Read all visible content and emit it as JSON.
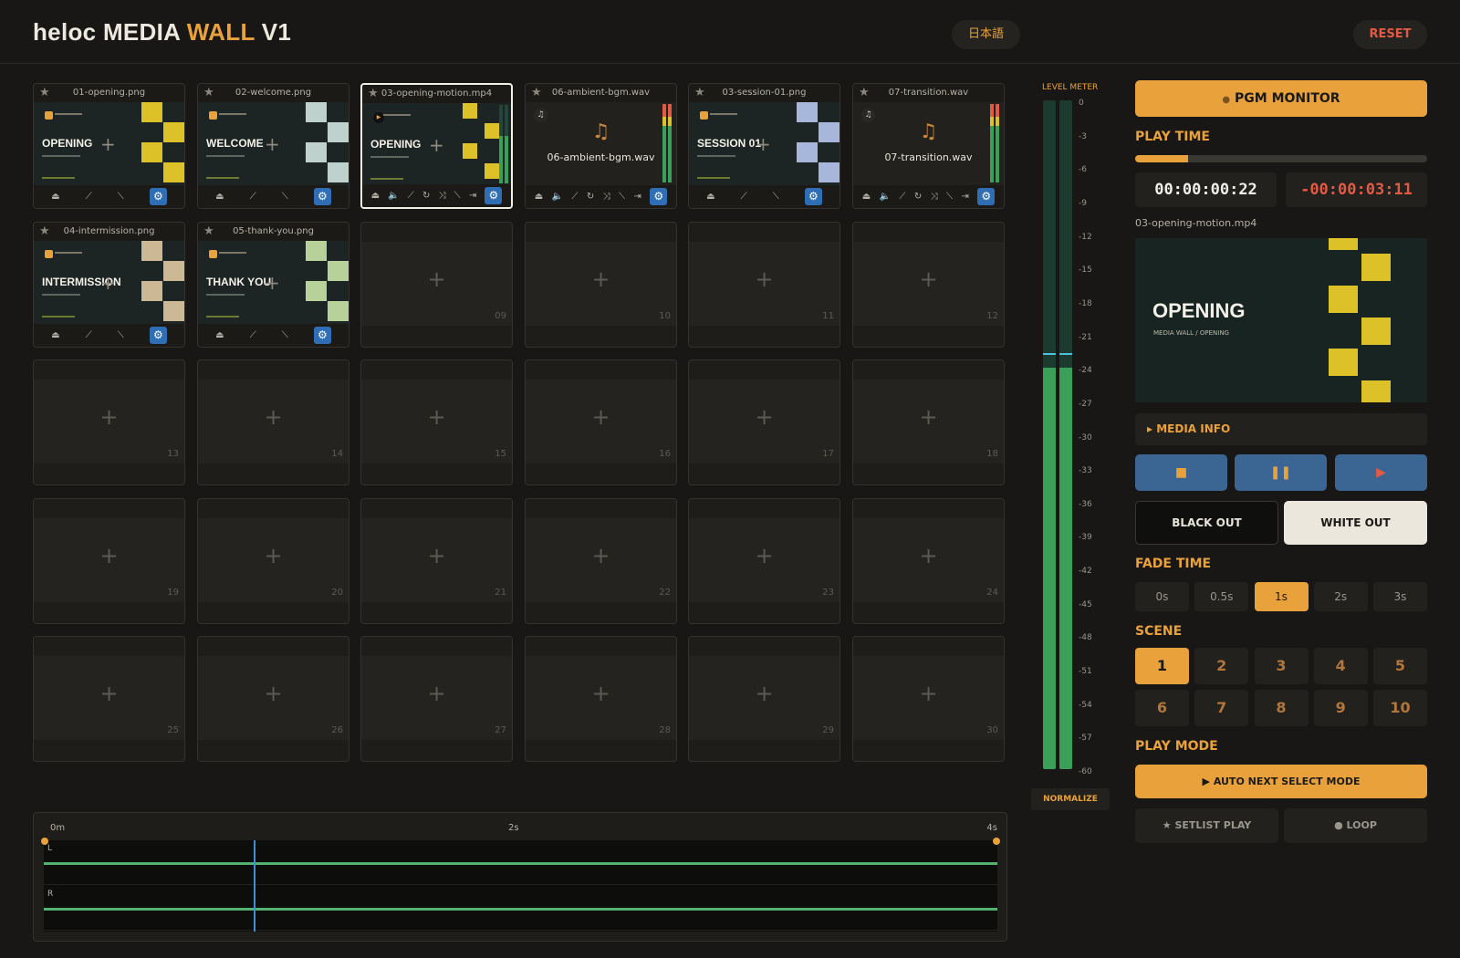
{
  "header": {
    "title_prefix": "heloc ",
    "title_main": "MEDIA ",
    "title_accent": "WALL",
    "title_suffix": " V1",
    "language_button": "日本語",
    "reset_button": "RESET"
  },
  "grid": {
    "filled": [
      {
        "file": "01-opening.png",
        "title": "OPENING",
        "type": "image",
        "color": "#dcc228"
      },
      {
        "file": "02-welcome.png",
        "title": "WELCOME",
        "type": "image",
        "color": "#bfd1cc"
      },
      {
        "file": "03-opening-motion.mp4",
        "title": "OPENING",
        "type": "video",
        "color": "#dcc228"
      },
      {
        "file": "06-ambient-bgm.wav",
        "title": "06-ambient-bgm.wav",
        "type": "audio"
      },
      {
        "file": "03-session-01.png",
        "title": "SESSION 01",
        "type": "image",
        "color": "#a9b6dc"
      },
      {
        "file": "07-transition.wav",
        "title": "07-transition.wav",
        "type": "audio"
      },
      {
        "file": "04-intermission.png",
        "title": "INTERMISSION",
        "type": "image",
        "color": "#ccb894"
      },
      {
        "file": "05-thank-you.png",
        "title": "THANK YOU",
        "type": "image",
        "color": "#b8d09a"
      }
    ],
    "empty_slots": [
      "09",
      "10",
      "11",
      "12",
      "13",
      "14",
      "15",
      "16",
      "17",
      "18",
      "19",
      "20",
      "21",
      "22",
      "23",
      "24",
      "25",
      "26",
      "27",
      "28",
      "29",
      "30"
    ]
  },
  "meter": {
    "label": "LEVEL METER",
    "ticks": [
      "0",
      "-3",
      "-6",
      "-9",
      "-12",
      "-15",
      "-18",
      "-21",
      "-24",
      "-27",
      "-30",
      "-33",
      "-36",
      "-39",
      "-42",
      "-45",
      "-48",
      "-51",
      "-54",
      "-57",
      "-60"
    ],
    "normalize_button": "NORMALIZE",
    "level_fraction": 0.6,
    "colors": {
      "fill": "#3aa059",
      "peak": "#4cc3d6"
    }
  },
  "timeline": {
    "marks": [
      "0m",
      "2s",
      "4s"
    ],
    "channels": [
      "L",
      "R"
    ],
    "playhead_fraction": 0.22
  },
  "panel": {
    "pgm_monitor": "PGM MONITOR",
    "play_time_label": "PLAY TIME",
    "progress_fraction": 0.18,
    "elapsed": "00:00:00:22",
    "remaining": "-00:00:03:11",
    "clip_name": "03-opening-motion.mp4",
    "preview_title": "OPENING",
    "preview_subtitle": "MEDIA WALL / OPENING",
    "media_info": "MEDIA INFO",
    "black_out": "BLACK OUT",
    "white_out": "WHITE OUT",
    "fade_time_label": "FADE TIME",
    "fade_options": [
      "0s",
      "0.5s",
      "1s",
      "2s",
      "3s"
    ],
    "fade_selected": "1s",
    "scene_label": "SCENE",
    "scenes": [
      "1",
      "2",
      "3",
      "4",
      "5",
      "6",
      "7",
      "8",
      "9",
      "10"
    ],
    "scene_selected": "1",
    "play_mode_label": "PLAY MODE",
    "auto_next": "AUTO NEXT SELECT MODE",
    "setlist_play": "SETLIST PLAY",
    "loop": "LOOP"
  },
  "colors": {
    "accent": "#e9a23b",
    "danger": "#e25a43",
    "transport": "#3b6593",
    "gear": "#2f6db5"
  }
}
